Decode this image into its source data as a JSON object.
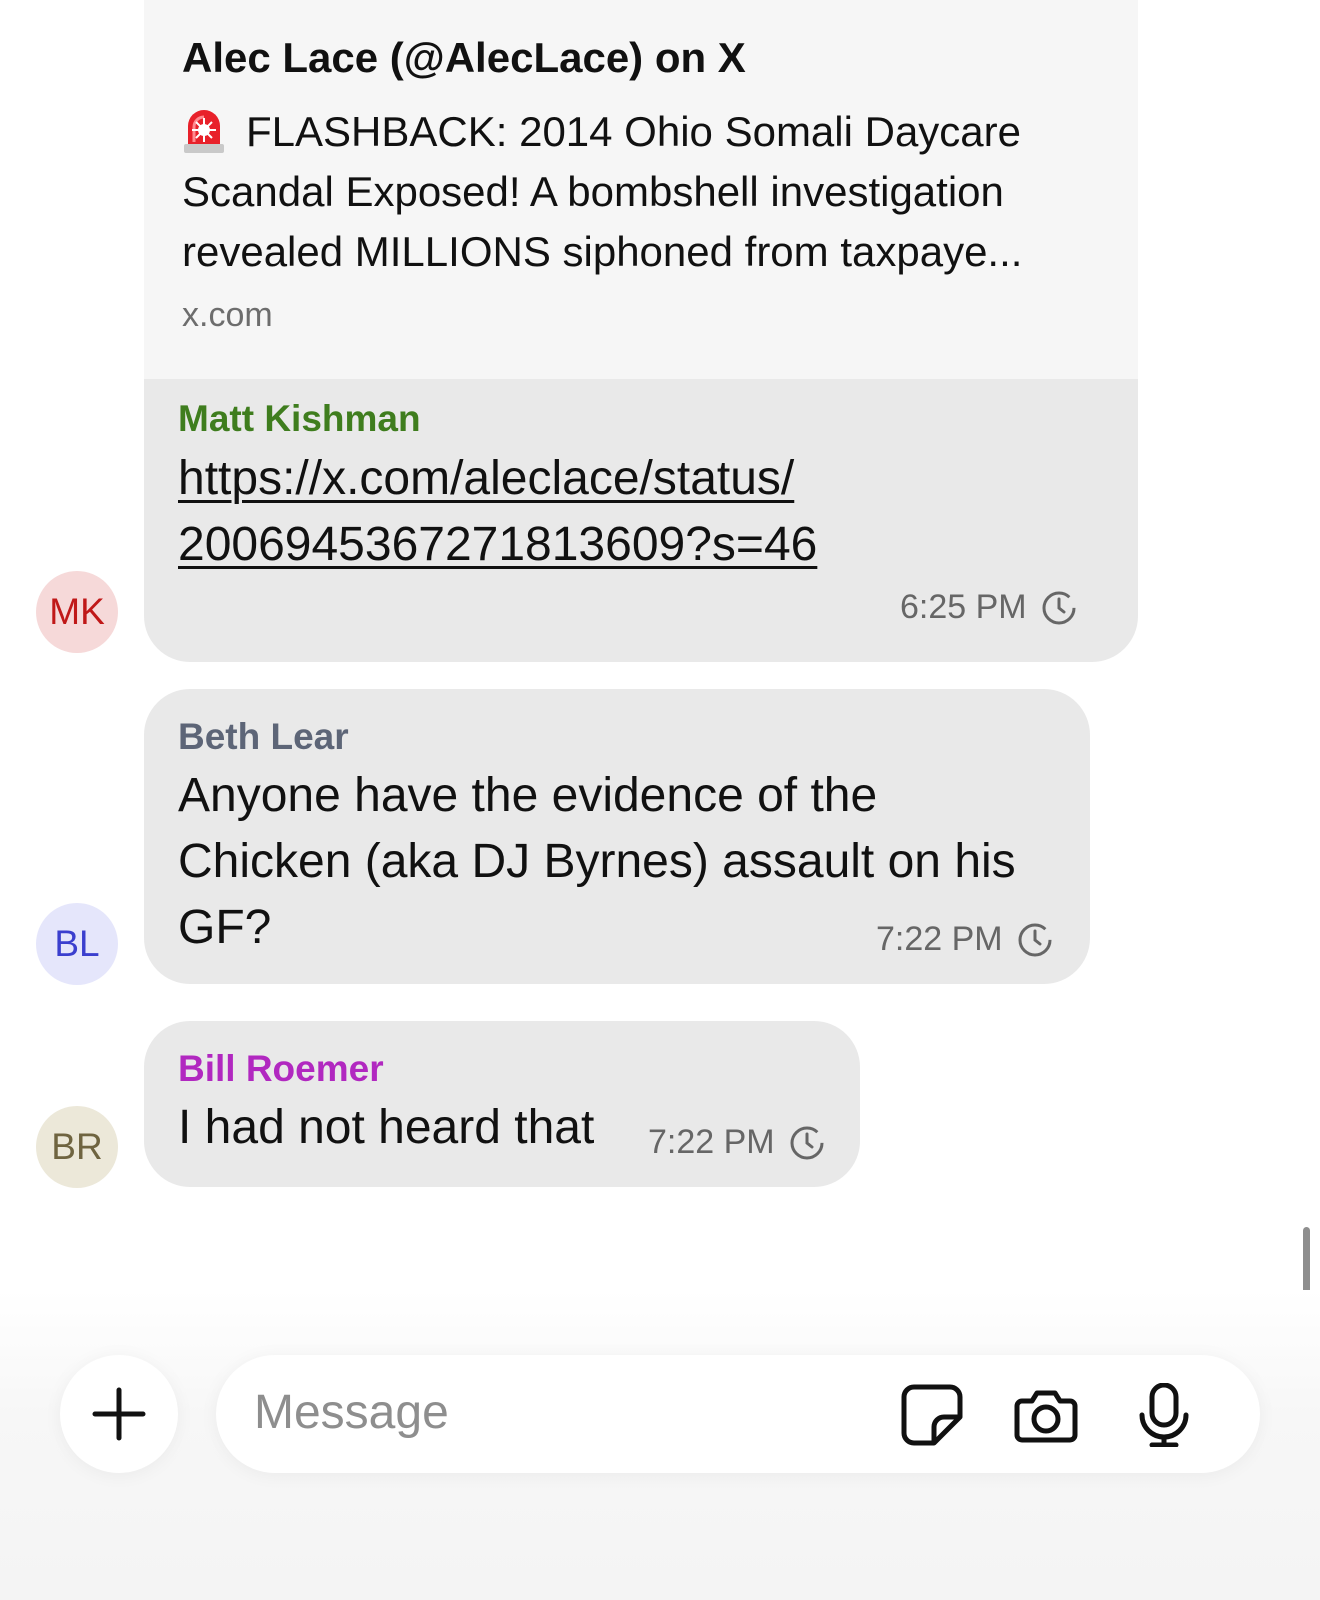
{
  "link_preview": {
    "title": "Alec Lace (@AlecLace) on X",
    "description": "FLASHBACK: 2014 Ohio Somali Daycare Scandal Exposed! A bombshell investigation revealed MILLIONS siphoned from taxpaye...",
    "emoji": "police-car-light",
    "domain": "x.com"
  },
  "messages": [
    {
      "sender": "Matt Kishman",
      "sender_color": "#3f7d1e",
      "text": "https://x.com/aleclace/status/2006945367271813609?s=46",
      "text_line1": "https://x.com/aleclace/status/",
      "text_line2": "2006945367271813609?s=46",
      "time": "6:25 PM",
      "avatar_initials": "MK",
      "avatar_bg": "#f6d9d9",
      "avatar_color": "#c01818"
    },
    {
      "sender": "Beth Lear",
      "sender_color": "#5d6577",
      "text_line1": "Anyone have the evidence of the",
      "text_line2": "Chicken (aka DJ Byrnes) assault on his",
      "text_line3": "GF?",
      "time": "7:22 PM",
      "avatar_initials": "BL",
      "avatar_bg": "#e5e6fb",
      "avatar_color": "#3b3fce"
    },
    {
      "sender": "Bill Roemer",
      "sender_color": "#b128c0",
      "text": "I had not heard that",
      "time": "7:22 PM",
      "avatar_initials": "BR",
      "avatar_bg": "#ece8d9",
      "avatar_color": "#6f6440"
    }
  ],
  "composer": {
    "placeholder": "Message",
    "icons": [
      "plus-icon",
      "sticker-icon",
      "camera-icon",
      "microphone-icon"
    ]
  }
}
